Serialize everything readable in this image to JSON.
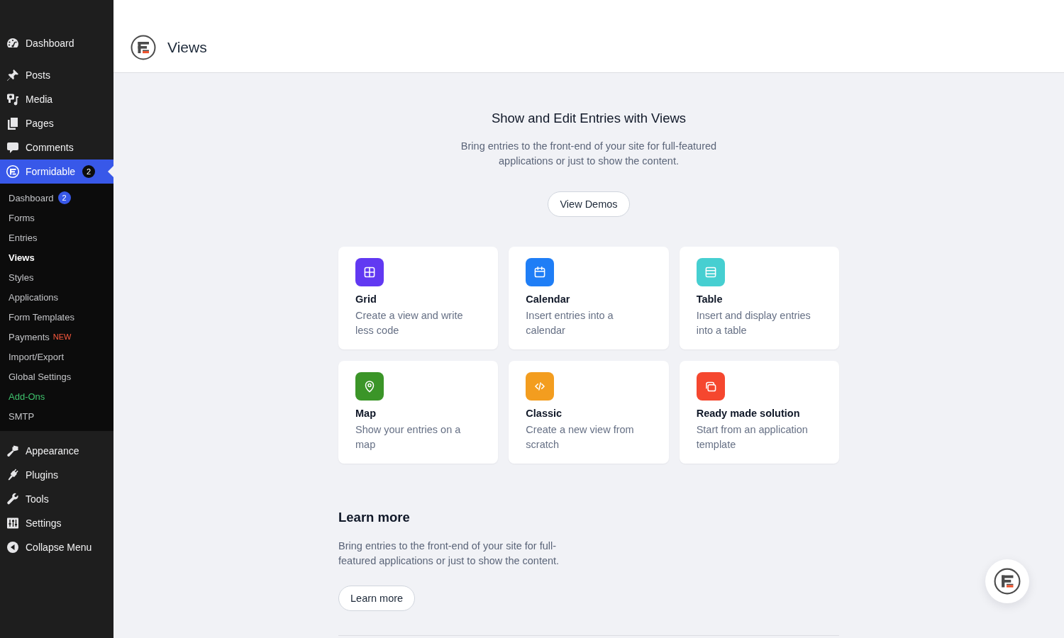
{
  "sidebar": {
    "groups": [
      {
        "items": [
          {
            "label": "Dashboard",
            "selected": false
          }
        ]
      },
      {
        "items": [
          {
            "label": "Posts",
            "selected": false
          },
          {
            "label": "Media",
            "selected": false
          },
          {
            "label": "Pages",
            "selected": false
          },
          {
            "label": "Comments",
            "selected": false
          },
          {
            "label": "Formidable",
            "selected": true,
            "badge": "2",
            "submenu": [
              {
                "label": "Dashboard",
                "selected": false,
                "badge": "2"
              },
              {
                "label": "Forms",
                "selected": false
              },
              {
                "label": "Entries",
                "selected": false
              },
              {
                "label": "Views",
                "selected": true
              },
              {
                "label": "Styles",
                "selected": false
              },
              {
                "label": "Applications",
                "selected": false
              },
              {
                "label": "Form Templates",
                "selected": false
              },
              {
                "label": "Payments",
                "selected": false,
                "tag": "NEW"
              },
              {
                "label": "Import/Export",
                "selected": false
              },
              {
                "label": "Global Settings",
                "selected": false
              },
              {
                "label": "Add-Ons",
                "selected": false,
                "color": "#3fc36d"
              },
              {
                "label": "SMTP",
                "selected": false
              }
            ]
          }
        ]
      },
      {
        "items": [
          {
            "label": "Appearance",
            "selected": false
          },
          {
            "label": "Plugins",
            "selected": false
          },
          {
            "label": "Tools",
            "selected": false
          },
          {
            "label": "Settings",
            "selected": false
          }
        ]
      }
    ],
    "collapse_menu": "Collapse Menu"
  },
  "header": {
    "title": "Views"
  },
  "intro": {
    "heading": "Show and Edit Entries with Views",
    "text": "Bring entries to the front-end of your site for full-featured applications or just to show the content.",
    "button": "View Demos"
  },
  "cards": [
    {
      "title": "Grid",
      "description": "Create a view and write less code",
      "color": "#6139f2"
    },
    {
      "title": "Calendar",
      "description": "Insert entries into a calendar",
      "color": "#1f7ef6"
    },
    {
      "title": "Table",
      "description": "Insert and display entries into a table",
      "color": "#46cfd1"
    },
    {
      "title": "Map",
      "description": "Show your entries on a map",
      "color": "#3b9528"
    },
    {
      "title": "Classic",
      "description": "Create a new view from scratch",
      "color": "#f39d1f"
    },
    {
      "title": "Ready made solution",
      "description": "Start from an application template",
      "color": "#f5472f"
    }
  ],
  "learn_more": {
    "heading": "Learn more",
    "text": "Bring entries to the front-end of your site for full-featured applications or just to show the content.",
    "button": "Learn more"
  }
}
